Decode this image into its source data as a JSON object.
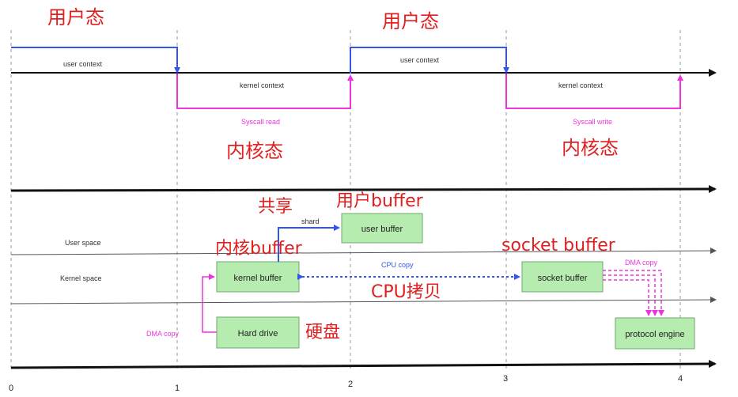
{
  "timeline_top": {
    "user_mode_labels": [
      "用户态",
      "用户态"
    ],
    "kernel_mode_labels": [
      "内核态",
      "内核态"
    ],
    "user_context": [
      "user context",
      "user context"
    ],
    "kernel_context": [
      "kernel context",
      "kernel context"
    ],
    "syscalls": [
      "Syscall read",
      "Syscall write"
    ]
  },
  "bottom": {
    "spaces": {
      "user": "User space",
      "kernel": "Kernel space"
    },
    "boxes": {
      "user_buffer": "user buffer",
      "kernel_buffer": "kernel buffer",
      "socket_buffer": "socket buffer",
      "hard_drive": "Hard drive",
      "protocol_engine": "protocol engine"
    },
    "arrows": {
      "shared": "shard",
      "cpu_copy": "CPU copy",
      "dma_copy_left": "DMA copy",
      "dma_copy_right": "DMA copy"
    },
    "annotations": {
      "shared_cn": "共享",
      "user_buffer_cn": "用户buffer",
      "kernel_buffer_cn": "内核buffer",
      "socket_buffer_en": "socket buffer",
      "cpu_copy_cn": "CPU拷贝",
      "hard_drive_cn": "硬盘"
    },
    "ticks": [
      "0",
      "1",
      "2",
      "3",
      "4"
    ]
  },
  "colors": {
    "annotation": "#e02020",
    "user_mode": "#3355ee",
    "kernel_mode": "#ee33dd",
    "box": "#b6ecb0"
  }
}
